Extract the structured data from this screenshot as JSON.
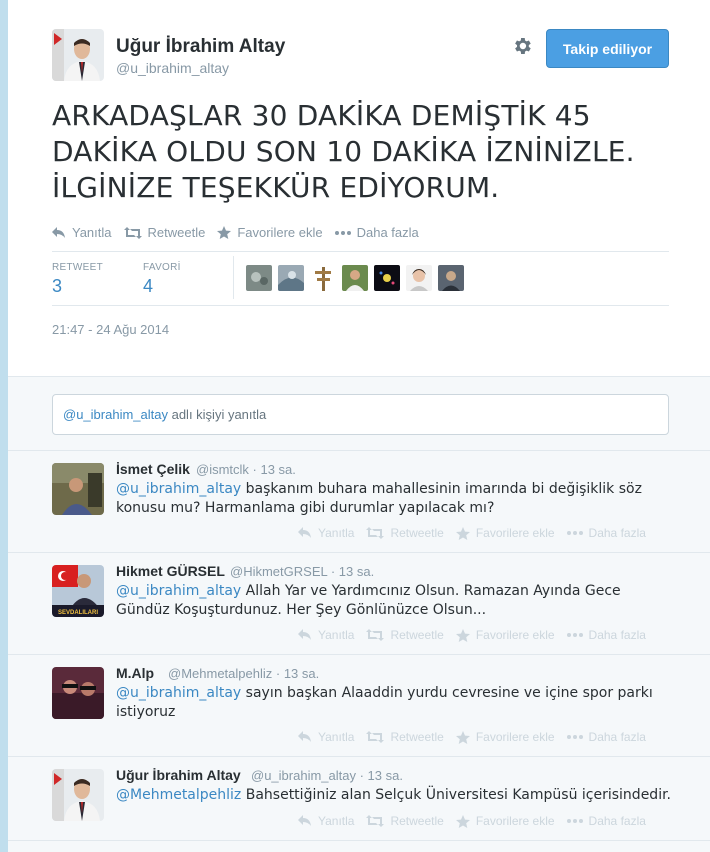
{
  "main_tweet": {
    "author_name": "Uğur İbrahim Altay",
    "author_handle": "@u_ibrahim_altay",
    "follow_label": "Takip ediliyor",
    "text": "ARKADAŞLAR 30 DAKİKA DEMİŞTİK 45 DAKİKA OLDU SON 10 DAKİKA İZNİNİZLE. İLGİNİZE TEŞEKKÜR EDİYORUM.",
    "actions": {
      "reply": "Yanıtla",
      "retweet": "Retweetle",
      "favorite": "Favorilere ekle",
      "more": "Daha fazla"
    },
    "stats": {
      "retweet_label": "RETWEET",
      "retweet_count": "3",
      "favorite_label": "FAVORİ",
      "favorite_count": "4"
    },
    "timestamp": "21:47 - 24 Ağu 2014"
  },
  "reply_box": {
    "mention": "@u_ibrahim_altay",
    "text": " adlı kişiyi yanıtla"
  },
  "replies": [
    {
      "name": "İsmet Çelik",
      "handle": "@ismtclk",
      "time": "· 13 sa.",
      "mention": "@u_ibrahim_altay",
      "text": " başkanım buhara mahallesinin imarında bi değişiklik söz konusu mu? Harmanlama gibi durumlar yapılacak mı?"
    },
    {
      "name": "Hikmet GÜRSEL",
      "handle": "@HikmetGRSEL",
      "time": "· 13 sa.",
      "mention": "@u_ibrahim_altay",
      "text": " Allah Yar ve Yardımcınız Olsun. Ramazan Ayında Gece Gündüz Koşuşturdunuz. Her Şey Gönlünüzce Olsun..."
    },
    {
      "name": "M.Alp",
      "handle": "@Mehmetalpehliz",
      "time": "· 13 sa.",
      "mention": "@u_ibrahim_altay",
      "text": " sayın başkan Alaaddin yurdu cevresine ve içine spor parkı istiyoruz"
    },
    {
      "name": "Uğur İbrahim Altay",
      "handle": "@u_ibrahim_altay",
      "time": "· 13 sa.",
      "mention": "@Mehmetalpehliz",
      "text": " Bahsettiğiniz alan Selçuk Üniversitesi Kampüsü içerisindedir."
    }
  ],
  "reply_actions": {
    "reply": "Yanıtla",
    "retweet": "Retweetle",
    "favorite": "Favorilere ekle",
    "more": "Daha fazla"
  },
  "avatar_badge_text": "SEVDALILARI",
  "colors": {
    "link": "#3b88c3",
    "follow_button": "#4b9fe3",
    "muted": "#8899a6",
    "background": "#c0deed"
  }
}
